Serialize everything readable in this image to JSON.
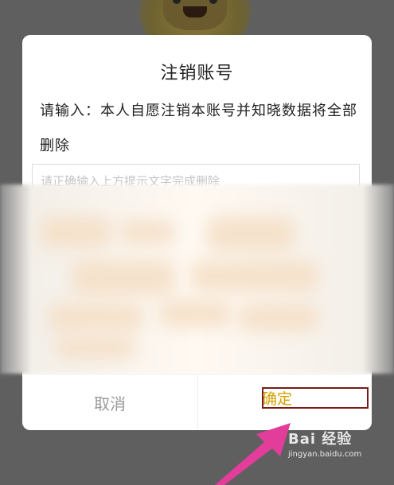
{
  "dialog": {
    "title": "注销账号",
    "message": "请输入：本人自愿注销本账号并知晓数据将全部删除",
    "input_placeholder": "请正确输入上方提示文字完成删除",
    "input_value": "",
    "cancel_label": "取消",
    "confirm_label": "确定"
  },
  "watermark": {
    "brand": "Bai 经验",
    "url": "jingyan.baidu.com"
  },
  "colors": {
    "overlay": "#5f5f5f",
    "confirm_text": "#d4a100",
    "cancel_text": "#9a9a9a",
    "highlight_box": "#7a1a1a",
    "arrow": "#e23d9b"
  }
}
